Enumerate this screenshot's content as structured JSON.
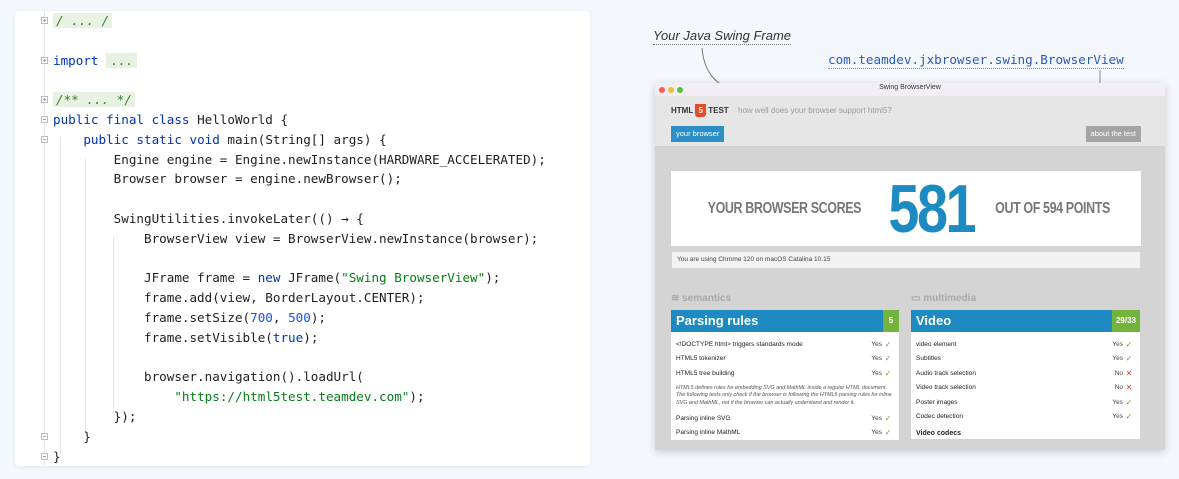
{
  "editor": {
    "lines": [
      [
        {
          "t": "/ ... /",
          "c": "folded"
        }
      ],
      [],
      [
        {
          "t": "import ",
          "c": "kw"
        },
        {
          "t": "...",
          "c": "folded-plain"
        }
      ],
      [],
      [
        {
          "t": "/** ... */",
          "c": "folded"
        }
      ],
      [
        {
          "t": "public final class ",
          "c": "kw"
        },
        {
          "t": "HelloWorld {",
          "c": ""
        }
      ],
      [
        {
          "t": "    "
        },
        {
          "t": "public static void ",
          "c": "kw"
        },
        {
          "t": "main(String[] args) {",
          "c": ""
        }
      ],
      [
        {
          "t": "        Engine engine = Engine.newInstance(HARDWARE_ACCELERATED);"
        }
      ],
      [
        {
          "t": "        Browser browser = engine.newBrowser();"
        }
      ],
      [],
      [
        {
          "t": "        SwingUtilities.invokeLater(() → {"
        }
      ],
      [
        {
          "t": "            BrowserView view = BrowserView.newInstance(browser);"
        }
      ],
      [],
      [
        {
          "t": "            JFrame frame = "
        },
        {
          "t": "new ",
          "c": "kw"
        },
        {
          "t": "JFrame("
        },
        {
          "t": "\"Swing BrowserView\"",
          "c": "str"
        },
        {
          "t": ");"
        }
      ],
      [
        {
          "t": "            frame.add(view, BorderLayout.CENTER);"
        }
      ],
      [
        {
          "t": "            frame.setSize("
        },
        {
          "t": "700",
          "c": "num"
        },
        {
          "t": ", "
        },
        {
          "t": "500",
          "c": "num"
        },
        {
          "t": ");"
        }
      ],
      [
        {
          "t": "            frame.setVisible("
        },
        {
          "t": "true",
          "c": "kw"
        },
        {
          "t": ");"
        }
      ],
      [],
      [
        {
          "t": "            browser.navigation().loadUrl("
        }
      ],
      [
        {
          "t": "                "
        },
        {
          "t": "\"https://html5test.teamdev.com\"",
          "c": "str"
        },
        {
          "t": ");"
        }
      ],
      [
        {
          "t": "        });"
        }
      ],
      [
        {
          "t": "    }"
        }
      ],
      [
        {
          "t": "}"
        }
      ]
    ]
  },
  "labels": {
    "frame": "Your Java Swing Frame",
    "class": "com.teamdev.jxbrowser.swing.BrowserView"
  },
  "browser": {
    "window_title": "Swing BrowserView",
    "logo_left": "HTML",
    "logo_num": "5",
    "logo_right": "TEST",
    "tagline": "how well does your browser support html5?",
    "btn_your": "your browser",
    "btn_about": "about the test",
    "score_pre": "YOUR BROWSER SCORES",
    "score": "581",
    "score_post": "OUT OF 594 POINTS",
    "using": "You are using Chrome 120 on macOS Catalina 10.15",
    "section_left": "semantics",
    "section_right": "multimedia",
    "left_card": {
      "title": "Parsing rules",
      "badge": "5",
      "rows": [
        {
          "label": "<!DOCTYPE html> triggers standards mode",
          "res": "Yes",
          "ok": true
        },
        {
          "label": "HTML5 tokenizer",
          "res": "Yes",
          "ok": true
        },
        {
          "label": "HTML5 tree building",
          "res": "Yes",
          "ok": true
        }
      ],
      "note": "HTML5 defines rules for embedding SVG and MathML inside a regular HTML document. The following tests only check if the browser is following the HTML5 parsing rules for inline SVG and MathML, not if the browser can actually understand and render it.",
      "rows2": [
        {
          "label": "Parsing inline SVG",
          "res": "Yes",
          "ok": true
        },
        {
          "label": "Parsing inline MathML",
          "res": "Yes",
          "ok": true
        }
      ]
    },
    "right_card": {
      "title": "Video",
      "badge": "29/33",
      "rows": [
        {
          "label": "video element",
          "res": "Yes",
          "ok": true
        },
        {
          "label": "Subtitles",
          "res": "Yes",
          "ok": true
        },
        {
          "label": "Audio track selection",
          "res": "No",
          "ok": false
        },
        {
          "label": "Video track selection",
          "res": "No",
          "ok": false
        },
        {
          "label": "Poster images",
          "res": "Yes",
          "ok": true
        },
        {
          "label": "Codec detection",
          "res": "Yes",
          "ok": true
        }
      ],
      "subhead": "Video codecs"
    },
    "colors": {
      "accent": "#1d8ac1",
      "badge": "#74b43e",
      "dot_red": "#fc5b57",
      "dot_yellow": "#e5bf3c",
      "dot_green": "#57c038"
    }
  }
}
